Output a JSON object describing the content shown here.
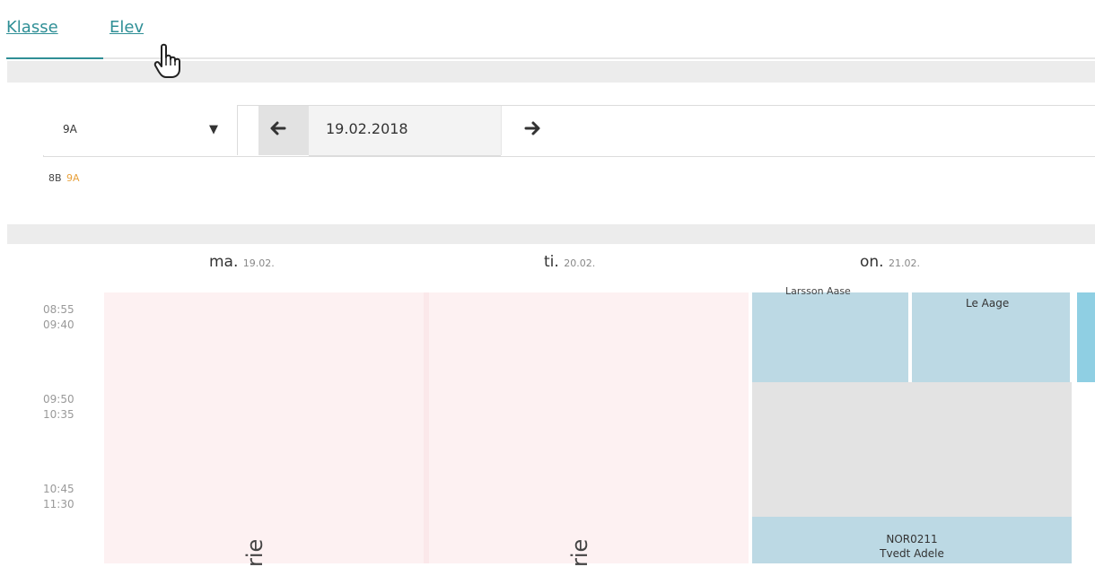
{
  "tabs": {
    "klasse": "Klasse",
    "elev": "Elev"
  },
  "filter": {
    "class_select_value": "9A",
    "date": "19.02.2018",
    "prev_arrow": "🡐",
    "next_arrow": "🡒",
    "caret": "▼",
    "class_links": [
      "8B",
      "9A"
    ]
  },
  "timetable": {
    "days": [
      {
        "name": "ma.",
        "date": "19.02."
      },
      {
        "name": "ti.",
        "date": "20.02."
      },
      {
        "name": "on.",
        "date": "21.02."
      }
    ],
    "periods": [
      {
        "start": "08:55",
        "end": "09:40"
      },
      {
        "start": "09:50",
        "end": "10:35"
      },
      {
        "start": "10:45",
        "end": "11:30"
      }
    ],
    "holiday_text_mon": "rie",
    "holiday_text_tue": "rie",
    "wed_cell_1a": "Larsson Aase",
    "wed_cell_1b": "Le Aage",
    "wed_cell_3_code": "NOR0211",
    "wed_cell_3_teacher": "Tvedt Adele"
  },
  "colors": {
    "accent": "#2f8f96",
    "highlight_class": "#e8a13c",
    "holiday": "#fdf1f2",
    "lesson": "#bcd9e4"
  },
  "icons": [
    "arrow-left-icon",
    "arrow-right-icon",
    "dropdown-caret-icon",
    "hand-cursor-icon"
  ]
}
